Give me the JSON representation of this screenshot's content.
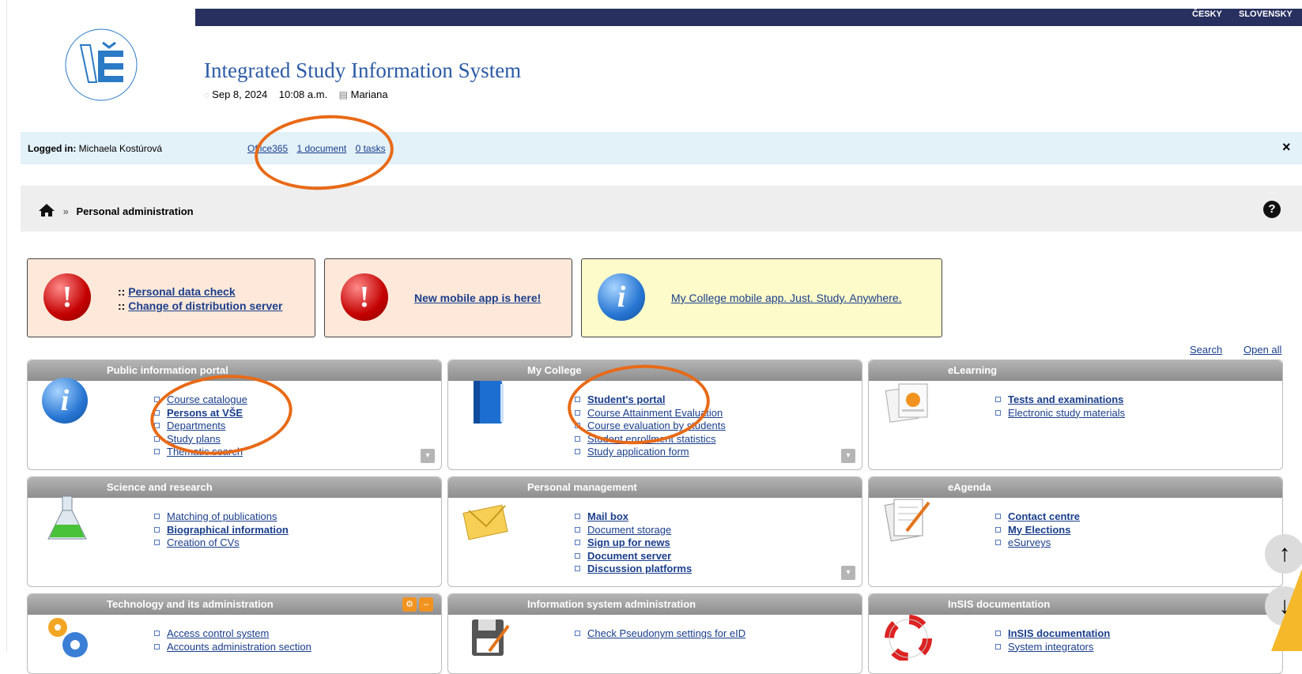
{
  "header": {
    "languages": [
      "ČESKY",
      "SLOVENSKY"
    ],
    "logo": {
      "ring_text": "UNIVERSITY OF ECONOMICS AND BUSINESS · PRAGUE",
      "mark": "VŠE"
    },
    "title": "Integrated Study Information System",
    "date": "Sep 8, 2024",
    "time": "10:08 a.m.",
    "user_short": "Mariana"
  },
  "logged": {
    "label": "Logged in:",
    "user": "Michaela Kostúrová",
    "links": [
      "Office365",
      "1 document",
      "0 tasks"
    ],
    "close": "×"
  },
  "breadcrumb": {
    "sep": "»",
    "current": "Personal administration",
    "help": "?"
  },
  "notices": [
    {
      "links": [
        "Personal data check",
        "Change of distribution server"
      ],
      "prefix": "::",
      "icon": "alert-icon",
      "color": "#fde8d9"
    },
    {
      "links": [
        "New mobile app is here!"
      ],
      "icon": "alert-icon",
      "color": "#fde8d9"
    },
    {
      "links": [
        "My College mobile app. Just. Study. Anywhere."
      ],
      "icon": "info-icon",
      "color": "#fdfbc9"
    }
  ],
  "toplinks": {
    "search": "Search",
    "open_all": "Open all"
  },
  "boxes": [
    {
      "title": "Public information portal",
      "icon": "info-icon",
      "items": [
        {
          "text": "Course catalogue",
          "bold": false
        },
        {
          "text": "Persons at VŠE",
          "bold": true
        },
        {
          "text": "Departments",
          "bold": false
        },
        {
          "text": "Study plans",
          "bold": false
        },
        {
          "text": "Thematic search",
          "bold": false
        }
      ]
    },
    {
      "title": "My College",
      "icon": "book-icon",
      "items": [
        {
          "text": "Student's portal",
          "bold": true
        },
        {
          "text": "Course Attainment Evaluation",
          "bold": false
        },
        {
          "text": "Course evaluation by students",
          "bold": false
        },
        {
          "text": "Student enrollment statistics",
          "bold": false
        },
        {
          "text": "Study application form",
          "bold": false
        }
      ]
    },
    {
      "title": "eLearning",
      "icon": "elearning-icon",
      "items": [
        {
          "text": "Tests and examinations",
          "bold": true
        },
        {
          "text": "Electronic study materials",
          "bold": false
        }
      ]
    },
    {
      "title": "Science and research",
      "icon": "flask-icon",
      "items": [
        {
          "text": "Matching of publications",
          "bold": false
        },
        {
          "text": "Biographical information",
          "bold": true
        },
        {
          "text": "Creation of CVs",
          "bold": false
        }
      ]
    },
    {
      "title": "Personal management",
      "icon": "mail-icon",
      "items": [
        {
          "text": "Mail box",
          "bold": true
        },
        {
          "text": "Document storage",
          "bold": false
        },
        {
          "text": "Sign up for news",
          "bold": true
        },
        {
          "text": "Document server",
          "bold": true
        },
        {
          "text": "Discussion platforms",
          "bold": true
        }
      ]
    },
    {
      "title": "eAgenda",
      "icon": "agenda-icon",
      "items": [
        {
          "text": "Contact centre",
          "bold": true
        },
        {
          "text": "My Elections",
          "bold": true
        },
        {
          "text": "eSurveys",
          "bold": false
        }
      ]
    },
    {
      "title": "Technology and its administration",
      "icon": "gears-icon",
      "items": [
        {
          "text": "Access control system",
          "bold": false
        },
        {
          "text": "Accounts administration section",
          "bold": false
        }
      ]
    },
    {
      "title": "Information system administration",
      "icon": "floppy-icon",
      "items": [
        {
          "text": "Check Pseudonym settings for eID",
          "bold": false
        }
      ]
    },
    {
      "title": "InSIS documentation",
      "icon": "lifebuoy-icon",
      "items": [
        {
          "text": "InSIS documentation",
          "bold": true
        },
        {
          "text": "System integrators",
          "bold": false
        }
      ]
    }
  ],
  "colors": {
    "topbar": "#27305f",
    "link": "#1a3e8c",
    "title": "#2c5aa6",
    "annotation": "#e86a17"
  }
}
